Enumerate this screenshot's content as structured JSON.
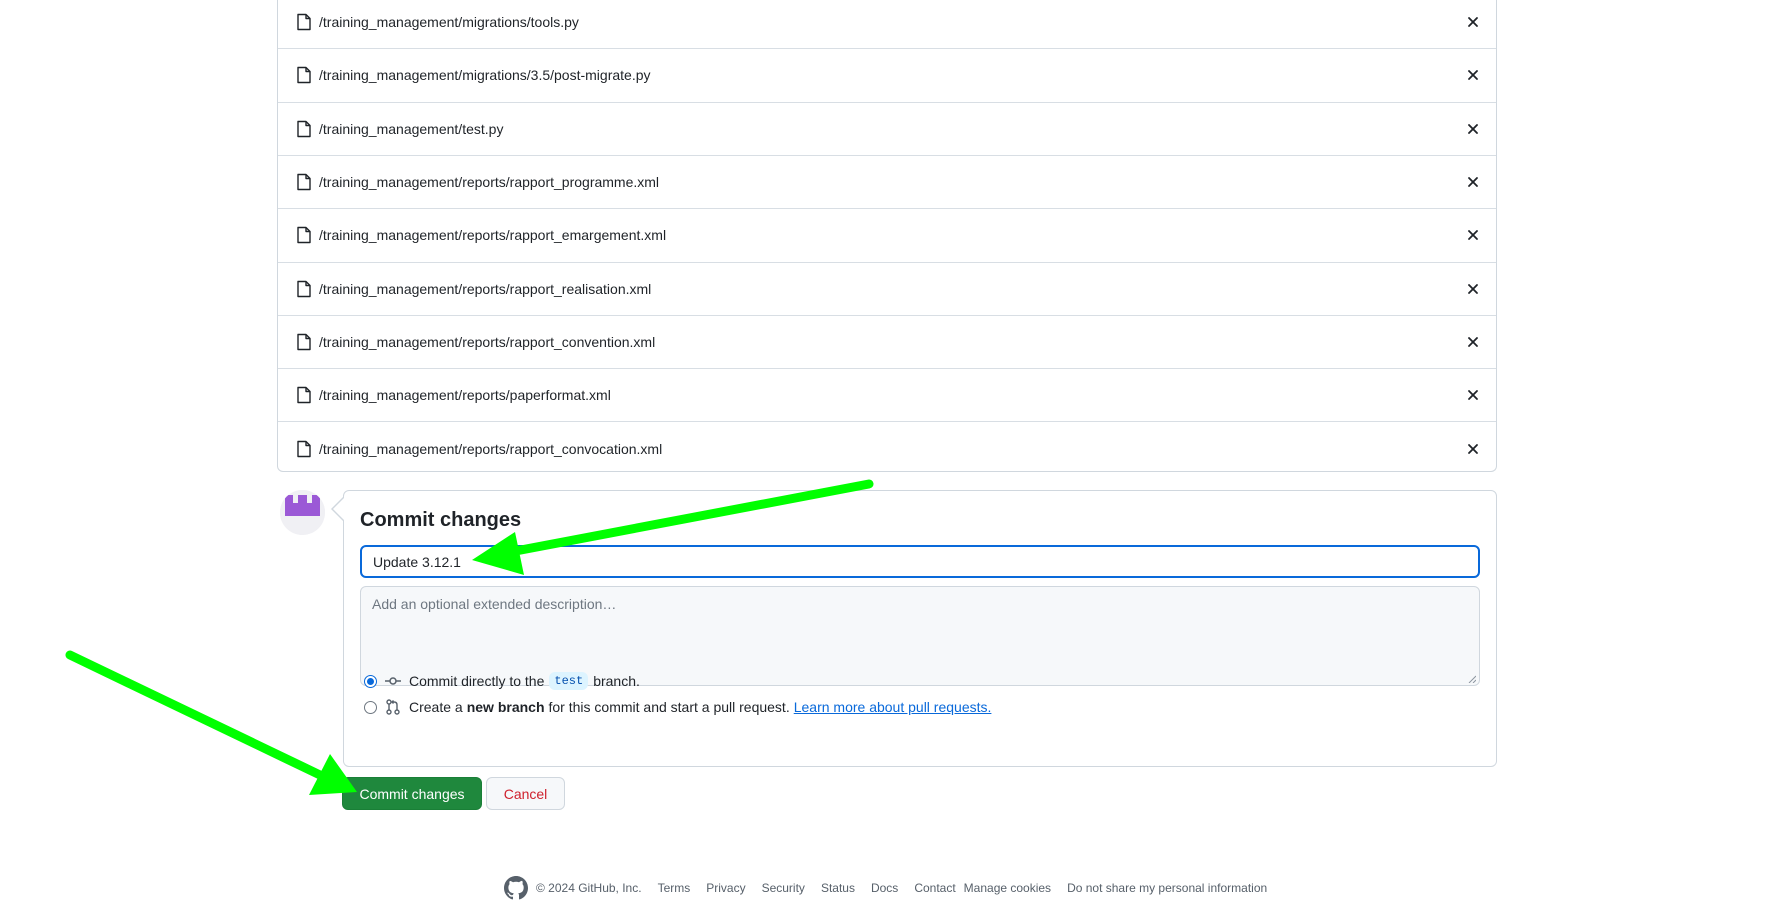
{
  "files": [
    {
      "path": "/training_management/migrations/tools.py"
    },
    {
      "path": "/training_management/migrations/3.5/post-migrate.py"
    },
    {
      "path": "/training_management/test.py"
    },
    {
      "path": "/training_management/reports/rapport_programme.xml"
    },
    {
      "path": "/training_management/reports/rapport_emargement.xml"
    },
    {
      "path": "/training_management/reports/rapport_realisation.xml"
    },
    {
      "path": "/training_management/reports/rapport_convention.xml"
    },
    {
      "path": "/training_management/reports/paperformat.xml"
    },
    {
      "path": "/training_management/reports/rapport_convocation.xml"
    }
  ],
  "commit": {
    "title": "Commit changes",
    "summary_value": "Update 3.12.1",
    "description_placeholder": "Add an optional extended description…",
    "option_direct": {
      "before": "Commit directly to the",
      "branch": "test",
      "after": "branch.",
      "selected": true
    },
    "option_new_branch": {
      "before": "Create a",
      "bold": "new branch",
      "after": "for this commit and start a pull request.",
      "link": "Learn more about pull requests.",
      "selected": false
    },
    "submit_label": "Commit changes",
    "cancel_label": "Cancel"
  },
  "footer": {
    "copyright": "© 2024 GitHub, Inc.",
    "links": [
      "Terms",
      "Privacy",
      "Security",
      "Status",
      "Docs",
      "Contact",
      "Manage cookies",
      "Do not share my personal information"
    ]
  },
  "colors": {
    "primary_button": "#1f883d",
    "cancel_text": "#cf222e",
    "focus_border": "#0969da",
    "link": "#0969da",
    "annotation_arrow": "#00ff00",
    "avatar": "#9b59d6"
  },
  "icons": [
    "file-icon",
    "close-icon",
    "git-commit-icon",
    "git-pull-request-icon",
    "github-mark-icon",
    "avatar-identicon"
  ]
}
